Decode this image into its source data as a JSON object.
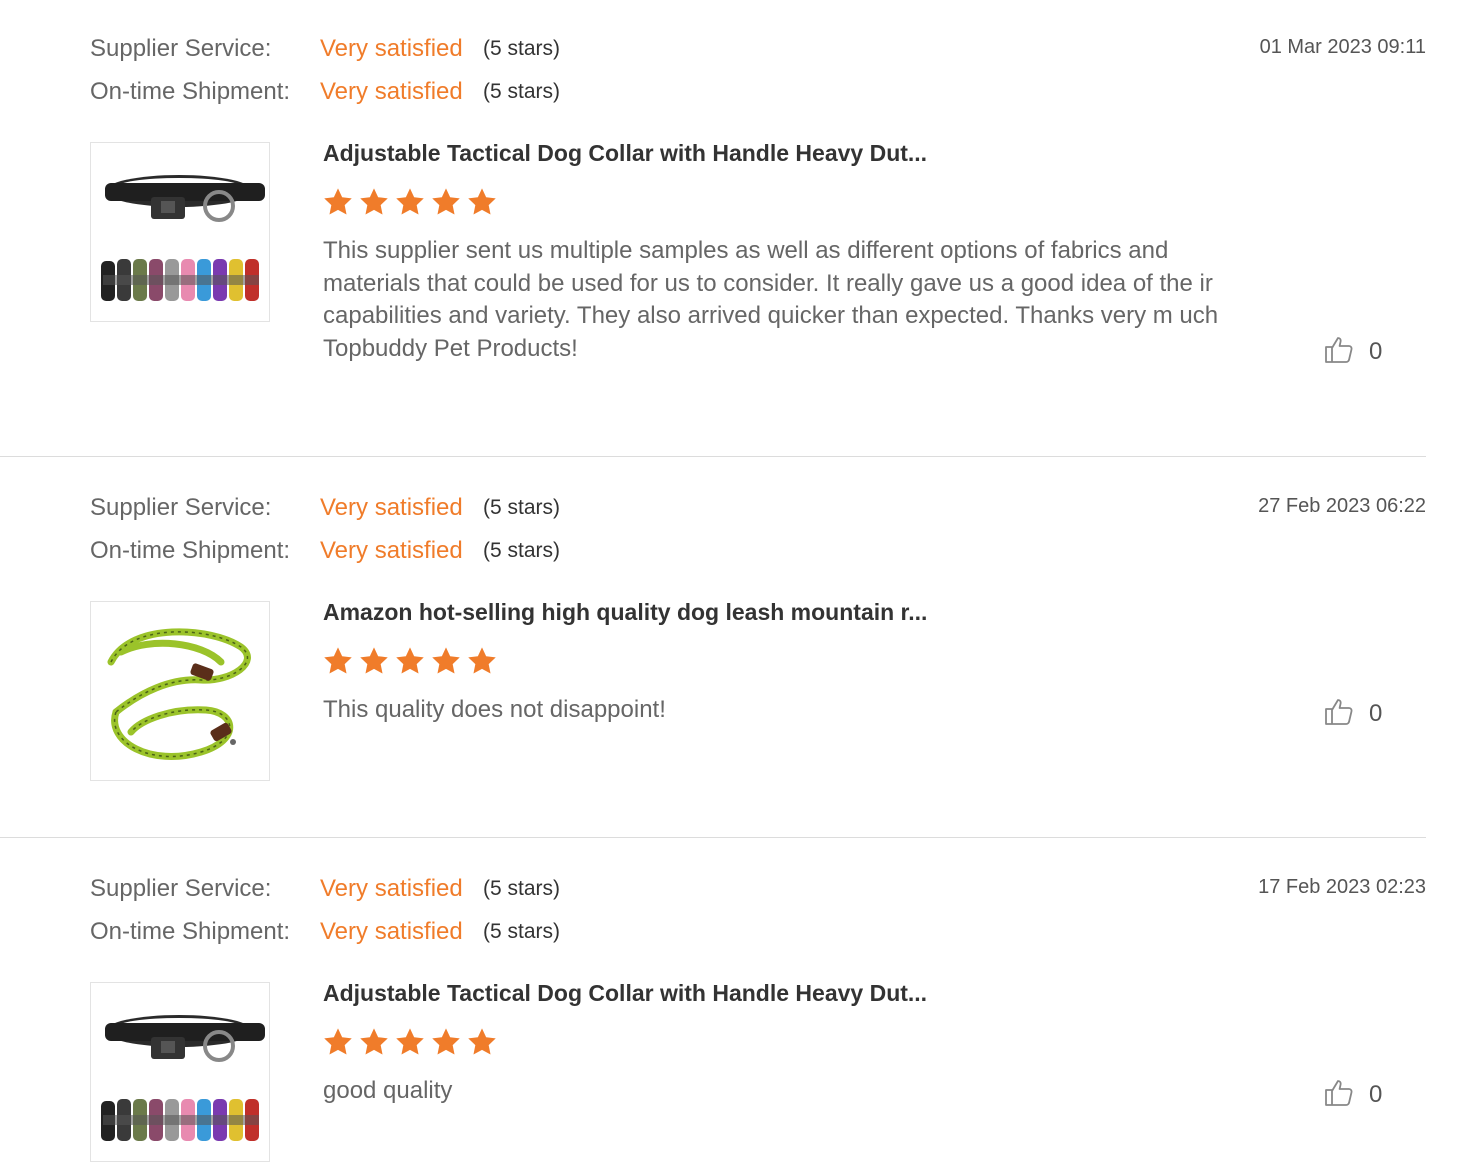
{
  "reviews": [
    {
      "supplier_service_label": "Supplier Service:",
      "supplier_service_value": "Very satisfied",
      "supplier_service_stars": "(5 stars)",
      "shipment_label": "On-time Shipment:",
      "shipment_value": "Very satisfied",
      "shipment_stars": "(5 stars)",
      "date": "01 Mar 2023 09:11",
      "product_title": "Adjustable Tactical Dog Collar with Handle Heavy Dut...",
      "rating": 5,
      "comment": "This supplier sent us multiple samples as well as different options of fabrics and materials that could be used for us to consider. It really gave us a good idea of the ir capabilities and variety. They also arrived quicker than expected. Thanks very m uch Topbuddy Pet Products!",
      "likes": "0",
      "image_icon": "dog-collar-image"
    },
    {
      "supplier_service_label": "Supplier Service:",
      "supplier_service_value": "Very satisfied",
      "supplier_service_stars": "(5 stars)",
      "shipment_label": "On-time Shipment:",
      "shipment_value": "Very satisfied",
      "shipment_stars": "(5 stars)",
      "date": "27 Feb 2023 06:22",
      "product_title": "Amazon hot-selling high quality dog leash mountain r...",
      "rating": 5,
      "comment": "This quality does not disappoint!",
      "likes": "0",
      "image_icon": "dog-leash-image"
    },
    {
      "supplier_service_label": "Supplier Service:",
      "supplier_service_value": "Very satisfied",
      "supplier_service_stars": "(5 stars)",
      "shipment_label": "On-time Shipment:",
      "shipment_value": "Very satisfied",
      "shipment_stars": "(5 stars)",
      "date": "17 Feb 2023 02:23",
      "product_title": "Adjustable Tactical Dog Collar with Handle Heavy Dut...",
      "rating": 5,
      "comment": "good quality",
      "likes": "0",
      "image_icon": "dog-collar-image"
    }
  ],
  "colors": {
    "accent": "#f07c2a",
    "star": "#f07c2a",
    "divider": "#dcdcdc"
  },
  "icons": {
    "star": "star-icon",
    "like": "thumbs-up-icon"
  }
}
